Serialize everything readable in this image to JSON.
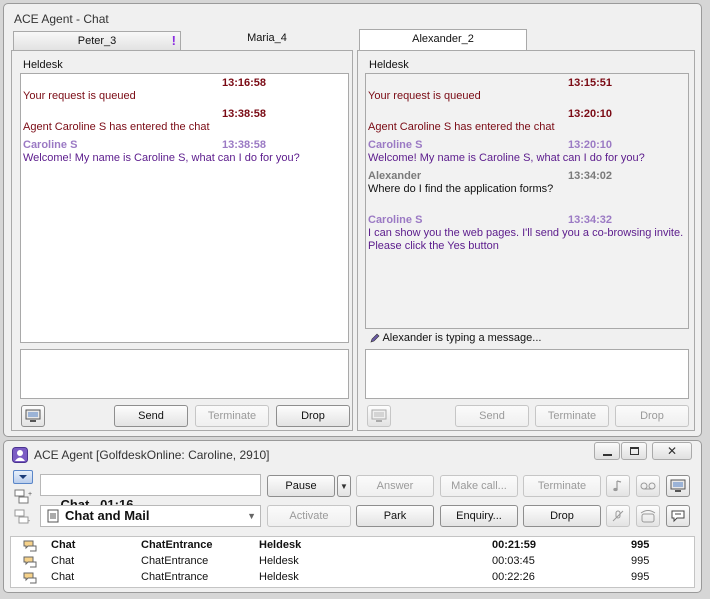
{
  "chat_window": {
    "title": "ACE Agent - Chat",
    "left": {
      "tabs": [
        {
          "label": "Peter_3",
          "alert": "!"
        },
        {
          "label": "Maria_4"
        }
      ],
      "queue": "Heldesk",
      "messages": [
        {
          "time": "13:16:58",
          "text": "Your request is queued"
        },
        {
          "time": "13:38:58",
          "text": "Agent Caroline S has entered the chat"
        },
        {
          "sender": "Caroline S",
          "time": "13:38:58",
          "text": "Welcome! My name is Caroline S, what can I do for you?"
        }
      ],
      "buttons": {
        "send": "Send",
        "terminate": "Terminate",
        "drop": "Drop"
      }
    },
    "right": {
      "tabs": [
        {
          "label": "Alexander_2"
        }
      ],
      "queue": "Heldesk",
      "messages": [
        {
          "time": "13:15:51",
          "text": "Your request is queued"
        },
        {
          "time": "13:20:10",
          "text": "Agent Caroline S has entered the chat"
        },
        {
          "sender": "Caroline S",
          "time": "13:20:10",
          "text": "Welcome! My name is Caroline S, what can I do for you?"
        },
        {
          "sender": "Alexander",
          "time": "13:34:02",
          "text": "Where do I find the application forms?"
        },
        {
          "sender": "Caroline S",
          "time": "13:34:32",
          "text_line1": "I can show you the web pages. I'll send you a co-browsing invite.",
          "text_line2": "Please click the Yes button"
        }
      ],
      "typing": "Alexander is typing a message...",
      "buttons": {
        "send": "Send",
        "terminate": "Terminate",
        "drop": "Drop"
      }
    }
  },
  "agent_window": {
    "title": "ACE Agent [GolfdeskOnline: Caroline, 2910]",
    "status_line": "Chat   01:16",
    "profile_select": "Chat and Mail",
    "buttons": {
      "pause": "Pause",
      "answer": "Answer",
      "make_call": "Make call...",
      "terminate": "Terminate",
      "activate": "Activate",
      "park": "Park",
      "enquiry": "Enquiry...",
      "drop": "Drop"
    },
    "queue_rows": [
      {
        "type": "Chat",
        "entrance": "ChatEntrance",
        "queue": "Heldesk",
        "time": "00:21:59",
        "number": "995"
      },
      {
        "type": "Chat",
        "entrance": "ChatEntrance",
        "queue": "Heldesk",
        "time": "00:03:45",
        "number": "995"
      },
      {
        "type": "Chat",
        "entrance": "ChatEntrance",
        "queue": "Heldesk",
        "time": "00:22:26",
        "number": "995"
      }
    ]
  },
  "colors": {
    "system_message": "#7a0a14",
    "agent_name": "#9b7ac4",
    "agent_text": "#5b1b8c",
    "customer_name": "#7a7a7a"
  },
  "icons": [
    "alert-icon",
    "co-browse-icon",
    "pencil-icon",
    "user-icon",
    "minimize-icon",
    "maximize-icon",
    "close-icon",
    "chat-queue-icon",
    "music-note-icon",
    "voicemail-icon",
    "mute-icon",
    "phone-icon",
    "transfer-icon"
  ]
}
